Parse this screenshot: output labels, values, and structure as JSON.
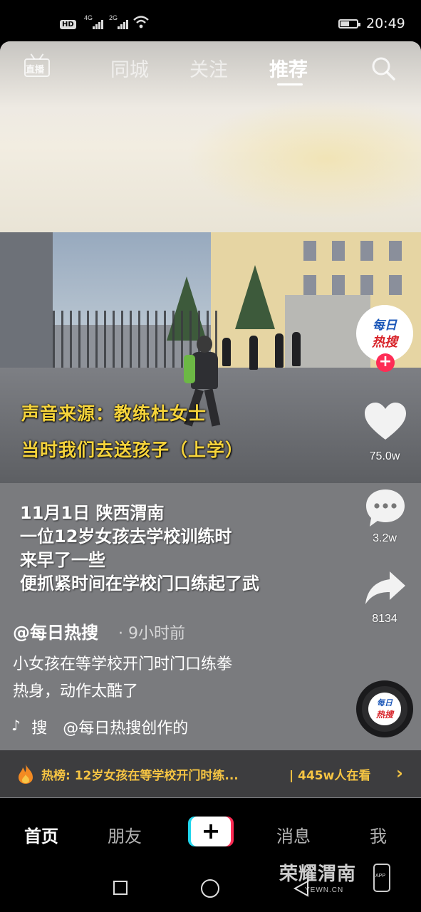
{
  "status_bar": {
    "hd": "HD",
    "net1": "4G",
    "net2": "2G",
    "battery_level": 0.55,
    "time": "20:49"
  },
  "top_nav": {
    "live_label": "直播",
    "tabs": [
      {
        "label": "同城"
      },
      {
        "label": "关注"
      },
      {
        "label": "推荐"
      }
    ],
    "active_tab": "推荐",
    "icons": [
      "live-icon",
      "search-icon"
    ]
  },
  "video": {
    "caption_line1": "声音来源：教练杜女士",
    "caption_line2": "当时我们去送孩子（上学）",
    "overlay_lines": [
      "11月1日 陕西渭南",
      "一位12岁女孩去学校训练时",
      "来早了一些",
      "便抓紧时间在学校门口练起了武"
    ]
  },
  "right_rail": {
    "avatar_line1": "每日",
    "avatar_line2": "热搜",
    "follow": "+",
    "likes": "75.0w",
    "comments": "3.2w",
    "shares": "8134",
    "icons": [
      "heart-icon",
      "comment-icon",
      "share-icon"
    ]
  },
  "post": {
    "author": "@每日热搜",
    "time_ago": "· 9小时前",
    "description_line1": "小女孩在等学校开门时门口练拳",
    "description_line2": "热身，动作太酷了",
    "music": " 搜 @每日热搜创作的"
  },
  "hot_bar": {
    "text": "热榜: 12岁女孩在等学校开门时练...",
    "count": "| 445w人在看",
    "color": "#f5c443"
  },
  "bottom_nav": {
    "items": [
      {
        "label": "首页"
      },
      {
        "label": "朋友"
      },
      {
        "label": "消息"
      },
      {
        "label": "我"
      }
    ],
    "plus": "+"
  },
  "watermark": {
    "title": "荣耀渭南",
    "url": "YEWN.CN",
    "app": "APP"
  },
  "colors": {
    "accent_red": "#fe2c55",
    "accent_cyan": "#20d5ec",
    "caption_yellow": "#f5d33b"
  }
}
